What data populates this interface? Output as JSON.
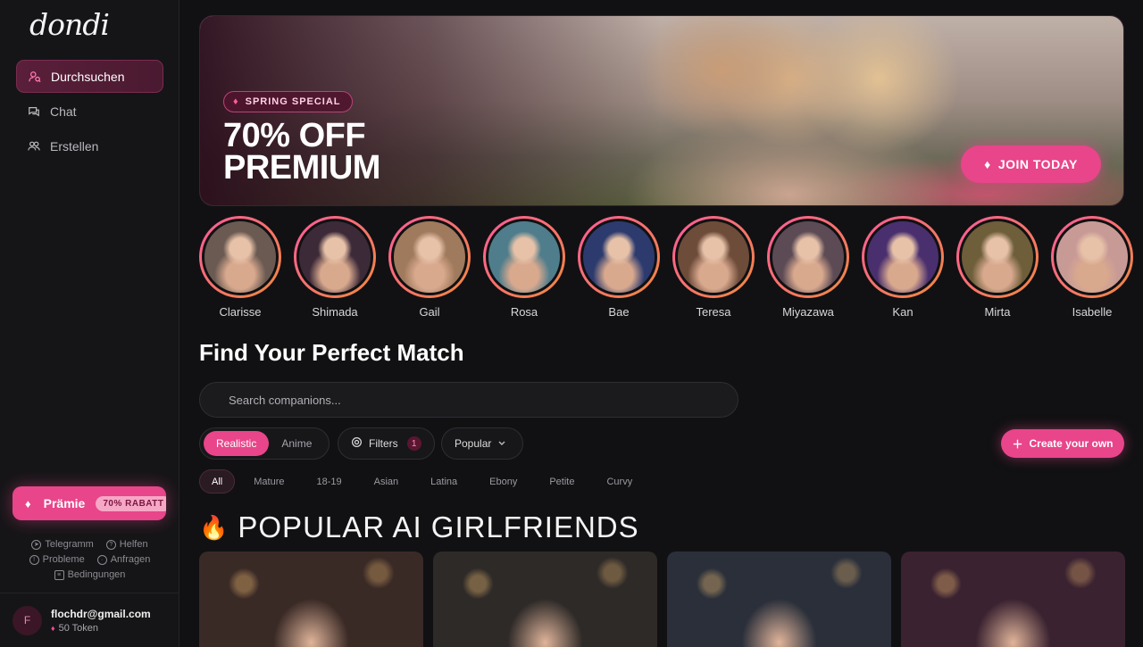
{
  "app": {
    "logo": "dondi"
  },
  "sidebar": {
    "items": [
      {
        "label": "Durchsuchen",
        "icon": "user-search-icon",
        "active": true
      },
      {
        "label": "Chat",
        "icon": "chat-icon",
        "active": false
      },
      {
        "label": "Erstellen",
        "icon": "users-icon",
        "active": false
      }
    ],
    "premium": {
      "label": "Prämie",
      "badge": "70% RABATT"
    },
    "links": {
      "telegram": "Telegramm",
      "help": "Helfen",
      "problems": "Probleme",
      "requests": "Anfragen",
      "terms": "Bedingungen"
    },
    "user": {
      "initial": "F",
      "email": "flochdr@gmail.com",
      "tokens": "50 Token"
    }
  },
  "banner": {
    "tag": "SPRING SPECIAL",
    "title_line1": "70% OFF",
    "title_line2": "PREMIUM",
    "cta": "JOIN TODAY"
  },
  "stories": [
    {
      "name": "Clarisse",
      "color": "#6b5a52"
    },
    {
      "name": "Shimada",
      "color": "#3d2a38"
    },
    {
      "name": "Gail",
      "color": "#a07a5c"
    },
    {
      "name": "Rosa",
      "color": "#4f7d8c"
    },
    {
      "name": "Bae",
      "color": "#2c3a6e"
    },
    {
      "name": "Teresa",
      "color": "#6e4c3a"
    },
    {
      "name": "Miyazawa",
      "color": "#5c4a55"
    },
    {
      "name": "Kan",
      "color": "#4a2f6e"
    },
    {
      "name": "Mirta",
      "color": "#6e5e3a"
    },
    {
      "name": "Isabelle",
      "color": "#c89a96"
    }
  ],
  "main": {
    "section_title": "Find Your Perfect Match",
    "search_placeholder": "Search companions...",
    "style_toggle": {
      "realistic": "Realistic",
      "anime": "Anime"
    },
    "filters": {
      "label": "Filters",
      "count": "1"
    },
    "sort": {
      "label": "Popular"
    },
    "create": "Create your own",
    "categories": [
      "All",
      "Mature",
      "18-19",
      "Asian",
      "Latina",
      "Ebony",
      "Petite",
      "Curvy"
    ],
    "popular_title": "POPULAR AI GIRLFRIENDS",
    "cards": [
      {
        "color": "#3a2a26"
      },
      {
        "color": "#2e2a28"
      },
      {
        "color": "#2a2f3a"
      },
      {
        "color": "#3a2230"
      }
    ]
  }
}
